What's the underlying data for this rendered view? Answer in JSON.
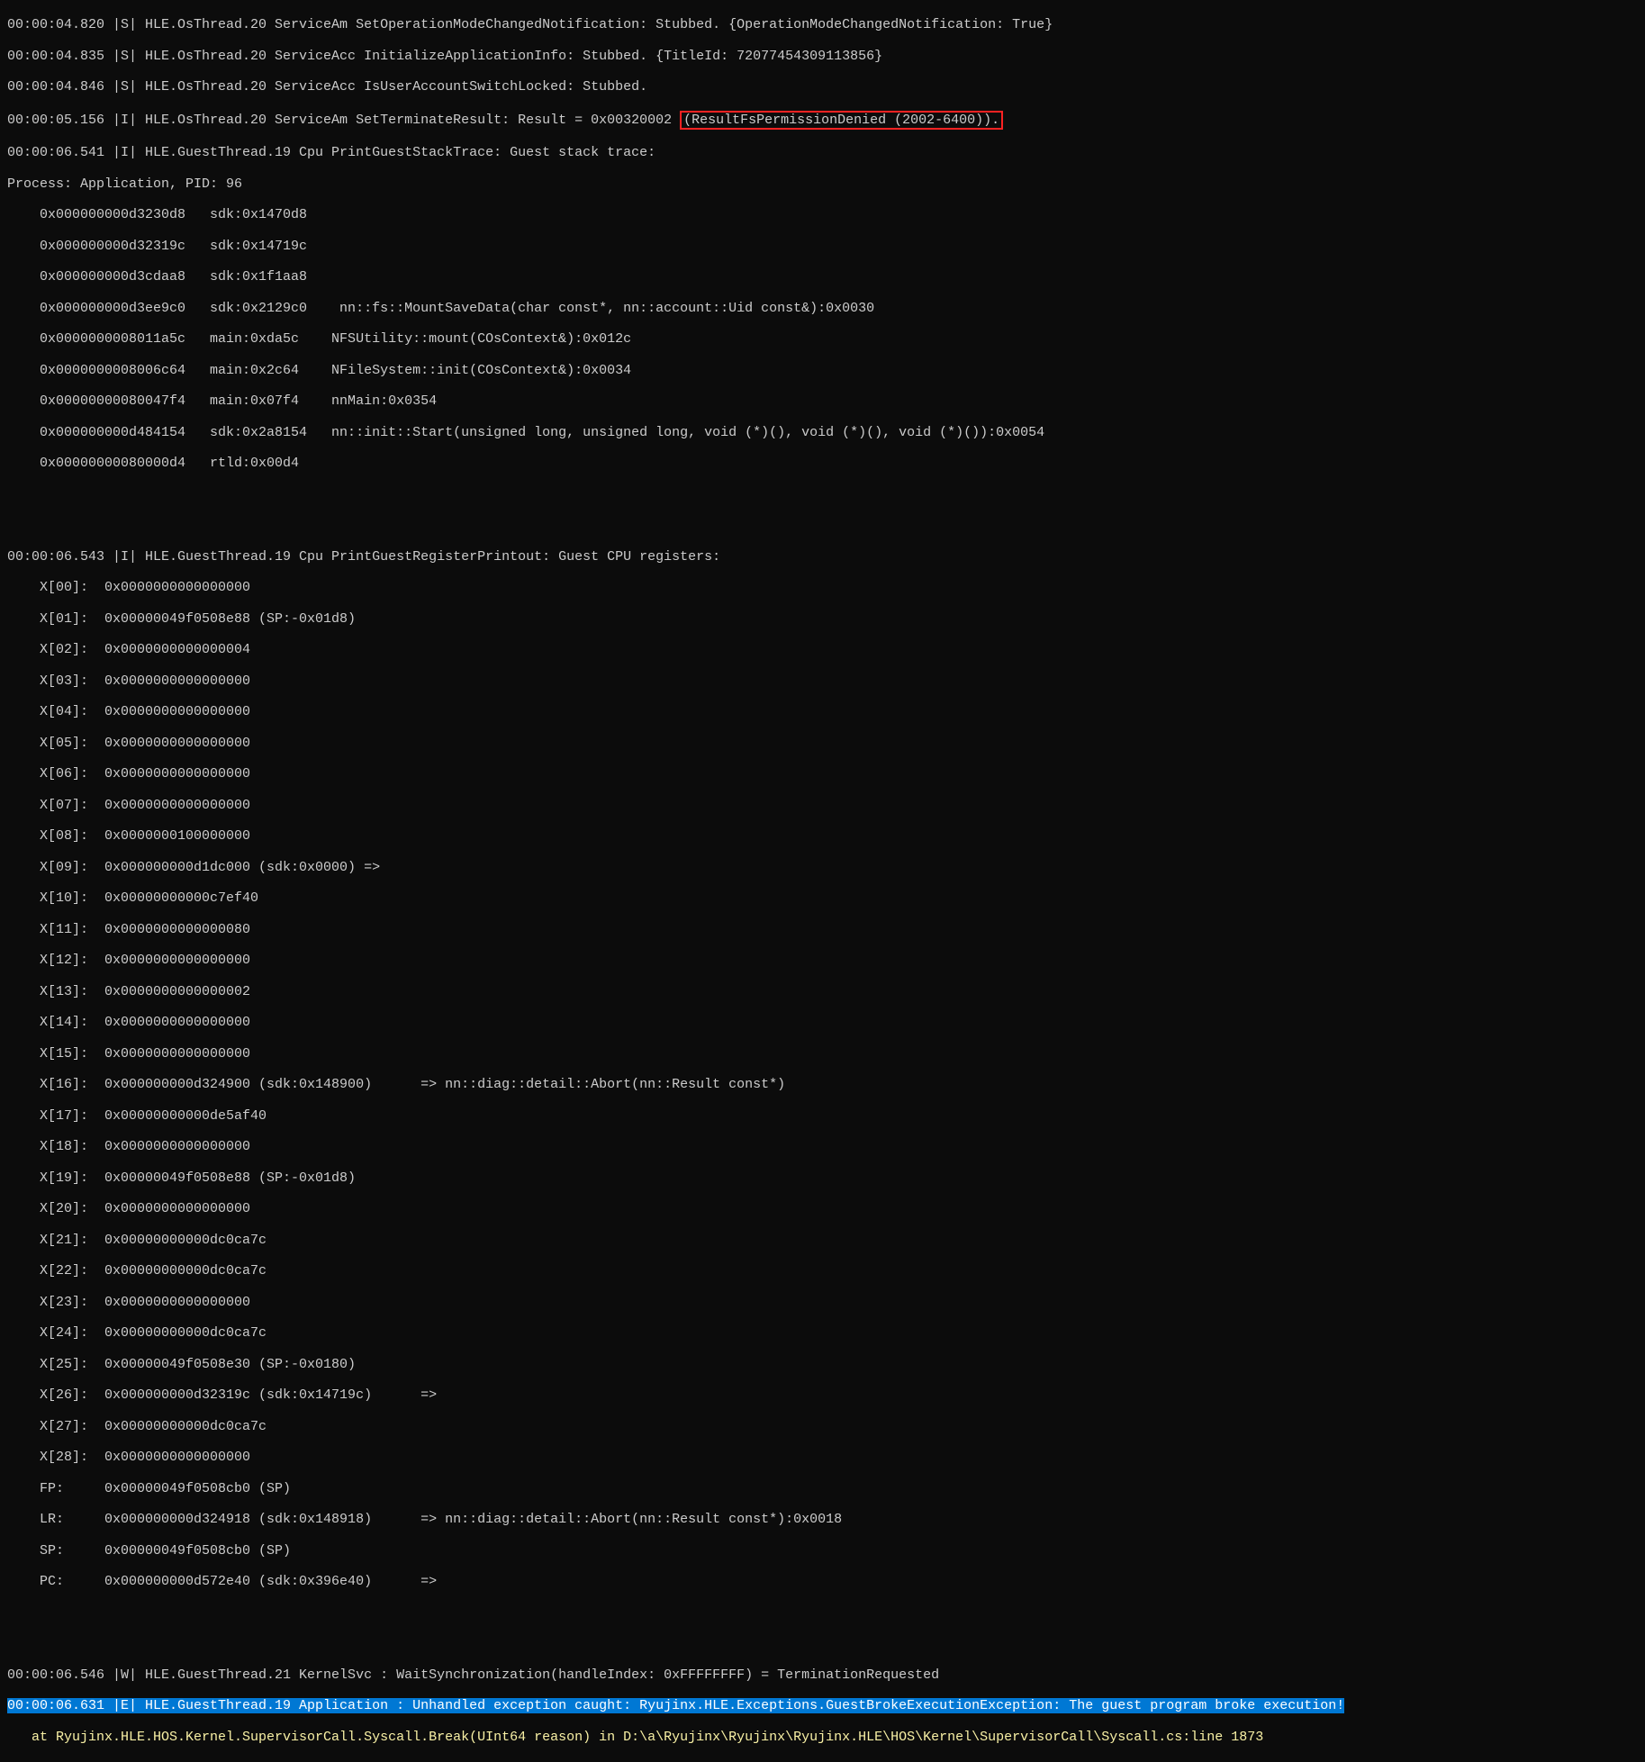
{
  "log": {
    "l00": "00:00:04.820 |S| HLE.OsThread.20 ServiceAm SetOperationModeChangedNotification: Stubbed. {OperationModeChangedNotification: True}",
    "l01": "00:00:04.835 |S| HLE.OsThread.20 ServiceAcc InitializeApplicationInfo: Stubbed. {TitleId: 72077454309113856}",
    "l02": "00:00:04.846 |S| HLE.OsThread.20 ServiceAcc IsUserAccountSwitchLocked: Stubbed.",
    "l03a": "00:00:05.156 |I| HLE.OsThread.20 ServiceAm SetTerminateResult: Result = 0x00320002 ",
    "l03b": "(ResultFsPermissionDenied (2002-6400)).",
    "l04": "00:00:06.541 |I| HLE.GuestThread.19 Cpu PrintGuestStackTrace: Guest stack trace:",
    "l05": "Process: Application, PID: 96",
    "l06": "    0x000000000d3230d8   sdk:0x1470d8",
    "l07": "    0x000000000d32319c   sdk:0x14719c",
    "l08": "    0x000000000d3cdaa8   sdk:0x1f1aa8",
    "l09": "    0x000000000d3ee9c0   sdk:0x2129c0    nn::fs::MountSaveData(char const*, nn::account::Uid const&):0x0030",
    "l10": "    0x0000000008011a5c   main:0xda5c    NFSUtility::mount(COsContext&):0x012c",
    "l11": "    0x0000000008006c64   main:0x2c64    NFileSystem::init(COsContext&):0x0034",
    "l12": "    0x00000000080047f4   main:0x07f4    nnMain:0x0354",
    "l13": "    0x000000000d484154   sdk:0x2a8154   nn::init::Start(unsigned long, unsigned long, void (*)(), void (*)(), void (*)()):0x0054",
    "l14": "    0x00000000080000d4   rtld:0x00d4",
    "l15": "",
    "l16": "",
    "l17": "00:00:06.543 |I| HLE.GuestThread.19 Cpu PrintGuestRegisterPrintout: Guest CPU registers:",
    "l18": "    X[00]:  0x0000000000000000",
    "l19": "    X[01]:  0x00000049f0508e88 (SP:-0x01d8)",
    "l20": "    X[02]:  0x0000000000000004",
    "l21": "    X[03]:  0x0000000000000000",
    "l22": "    X[04]:  0x0000000000000000",
    "l23": "    X[05]:  0x0000000000000000",
    "l24": "    X[06]:  0x0000000000000000",
    "l25": "    X[07]:  0x0000000000000000",
    "l26": "    X[08]:  0x0000000100000000",
    "l27": "    X[09]:  0x000000000d1dc000 (sdk:0x0000) =>",
    "l28": "    X[10]:  0x00000000000c7ef40",
    "l29": "    X[11]:  0x0000000000000080",
    "l30": "    X[12]:  0x0000000000000000",
    "l31": "    X[13]:  0x0000000000000002",
    "l32": "    X[14]:  0x0000000000000000",
    "l33": "    X[15]:  0x0000000000000000",
    "l34": "    X[16]:  0x000000000d324900 (sdk:0x148900)      => nn::diag::detail::Abort(nn::Result const*)",
    "l35": "    X[17]:  0x00000000000de5af40",
    "l36": "    X[18]:  0x0000000000000000",
    "l37": "    X[19]:  0x00000049f0508e88 (SP:-0x01d8)",
    "l38": "    X[20]:  0x0000000000000000",
    "l39": "    X[21]:  0x00000000000dc0ca7c",
    "l40": "    X[22]:  0x00000000000dc0ca7c",
    "l41": "    X[23]:  0x0000000000000000",
    "l42": "    X[24]:  0x00000000000dc0ca7c",
    "l43": "    X[25]:  0x00000049f0508e30 (SP:-0x0180)",
    "l44": "    X[26]:  0x000000000d32319c (sdk:0x14719c)      =>",
    "l45": "    X[27]:  0x00000000000dc0ca7c",
    "l46": "    X[28]:  0x0000000000000000",
    "l47": "    FP:     0x00000049f0508cb0 (SP)",
    "l48": "    LR:     0x000000000d324918 (sdk:0x148918)      => nn::diag::detail::Abort(nn::Result const*):0x0018",
    "l49": "    SP:     0x00000049f0508cb0 (SP)",
    "l50": "    PC:     0x000000000d572e40 (sdk:0x396e40)      =>",
    "l51": "",
    "l52": "",
    "l53": "00:00:06.546 |W| HLE.GuestThread.21 KernelSvc : WaitSynchronization(handleIndex: 0xFFFFFFFF) = TerminationRequested",
    "l54": "00:00:06.631 |E| HLE.GuestThread.19 Application : Unhandled exception caught: Ryujinx.HLE.Exceptions.GuestBrokeExecutionException: The guest program broke execution!",
    "l55": "   at Ryujinx.HLE.HOS.Kernel.SupervisorCall.Syscall.Break(UInt64 reason) in D:\\a\\Ryujinx\\Ryujinx\\Ryujinx.HLE\\HOS\\Kernel\\SupervisorCall\\Syscall.cs:line 1873"
  }
}
